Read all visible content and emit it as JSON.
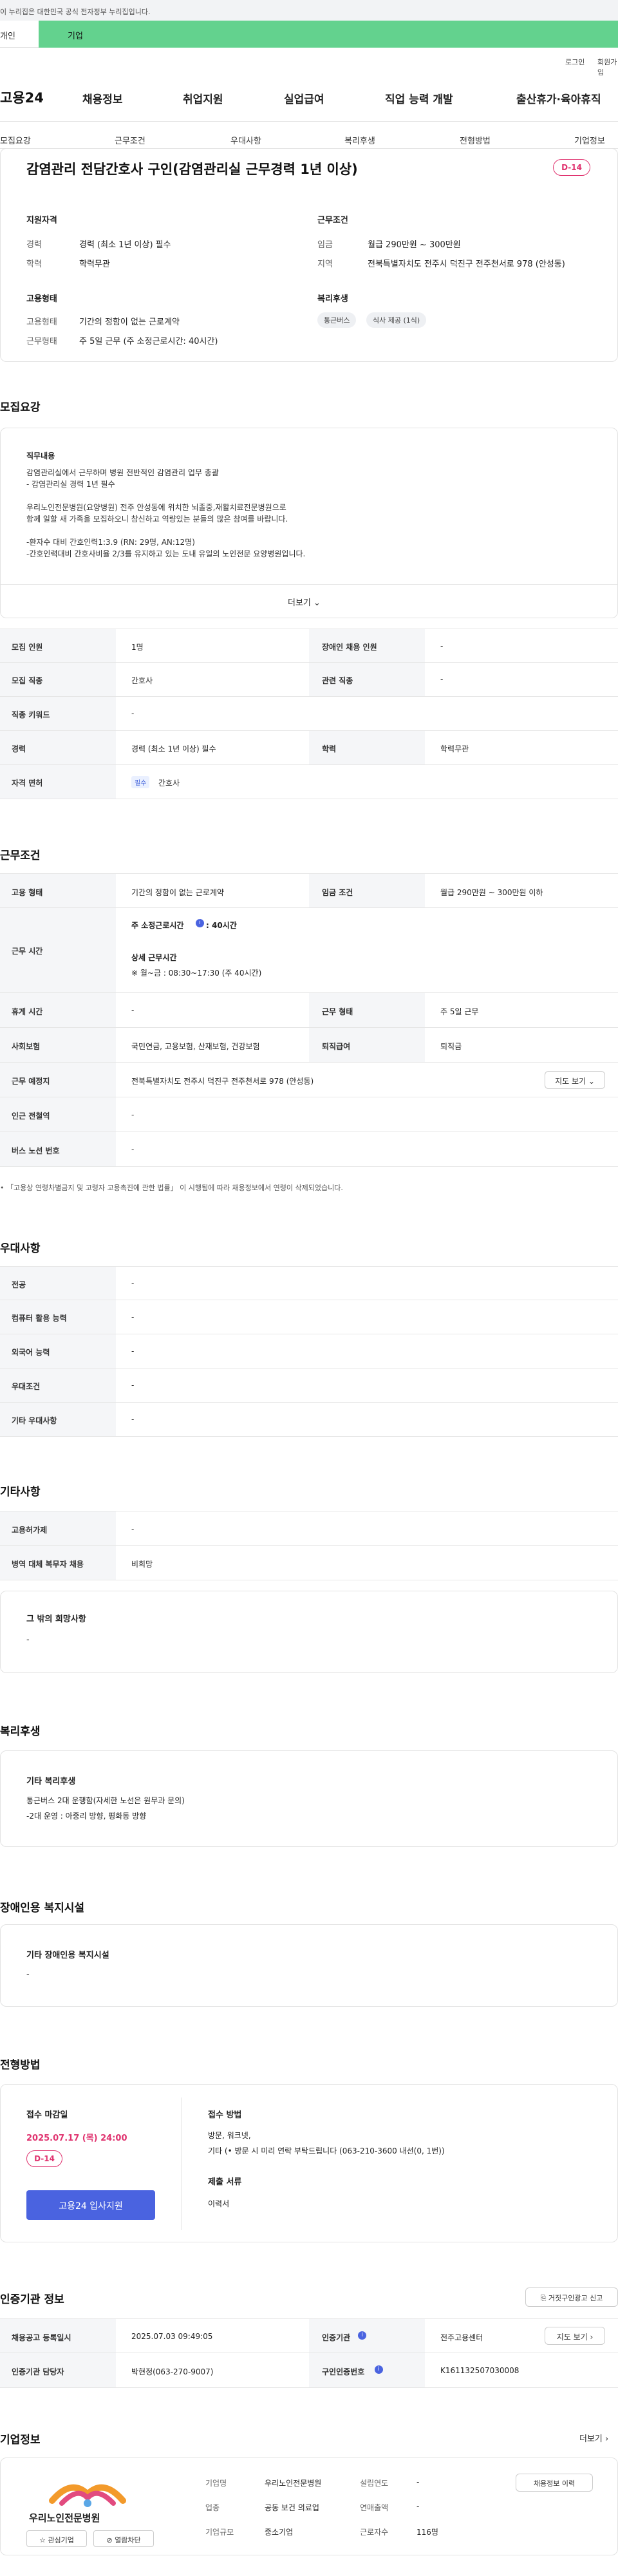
{
  "gov_banner": "이 누리집은 대한민국 공식 전자정부 누리집입니다.",
  "tabs": {
    "personal": "개인",
    "company": "기업"
  },
  "util": {
    "login": "로그인",
    "signup": "회원가입"
  },
  "logo": "고용24",
  "gnb": [
    "채용정보",
    "취업지원",
    "실업급여",
    "직업 능력 개발",
    "출산휴가·육아휴직"
  ],
  "subnav": [
    "모집요강",
    "근무조건",
    "우대사항",
    "복리후생",
    "전형방법",
    "기업정보"
  ],
  "job": {
    "title": "감염관리 전담간호사 구인(감염관리실 근무경력 1년 이상)",
    "dday": "D-14",
    "qual_title": "지원자격",
    "cond_title": "근무조건",
    "qual": [
      {
        "k": "경력",
        "v": "경력 (최소 1년 이상) 필수"
      },
      {
        "k": "학력",
        "v": "학력무관"
      }
    ],
    "cond": [
      {
        "k": "임금",
        "v": "월급 290만원 ~ 300만원"
      },
      {
        "k": "지역",
        "v": "전북특별자치도 전주시 덕진구 전주천서로 978 (안성동)"
      }
    ],
    "emp_title": "고용형태",
    "welfare_title": "복리후생",
    "emp": [
      {
        "k": "고용형태",
        "v": "기간의 정함이 없는 근로계약"
      },
      {
        "k": "근무형태",
        "v": "주 5일 근무 (주 소정근로시간: 40시간)"
      }
    ],
    "welfare_chips": [
      "통근버스",
      "식사 제공 (1식)"
    ]
  },
  "recruit": {
    "section": "모집요강",
    "duty_title": "직무내용",
    "duty_lines": [
      "감염관리실에서 근무하며 병원 전반적인 감염관리 업무 총괄",
      "- 감염관리실 경력 1년 필수",
      "",
      "우리노인전문병원(요양병원) 전주 안성동에 위치한 뇌졸중,재활치료전문병원으로",
      "함께 일할 새 가족을 모집하오니 참신하고 역량있는 분들의 많은 참여를 바랍니다.",
      "",
      "-환자수 대비 간호인력1:3.9 (RN: 29명, AN:12명)",
      "-간호인력대비 간호사비율 2/3를 유지하고 있는 도내 유일의 노인전문 요양병원입니다."
    ],
    "more": "더보기",
    "rows": [
      {
        "h1": "모집 인원",
        "v1": "1명",
        "h2": "장애인 채용 인원",
        "v2": "-"
      },
      {
        "h1": "모집 직종",
        "v1": "간호사",
        "h2": "관련 직종",
        "v2": "-"
      },
      {
        "h1": "직종 키워드",
        "v1": "-"
      },
      {
        "h1": "경력",
        "v1": "경력 (최소 1년 이상) 필수",
        "h2": "학력",
        "v2": "학력무관"
      },
      {
        "h1": "자격 면허",
        "badge": "필수",
        "v1": "간호사"
      }
    ]
  },
  "work": {
    "section": "근무조건",
    "emp_type_h": "고용 형태",
    "emp_type": "기간의 정함이 없는 근로계약",
    "wage_h": "임금 조건",
    "wage": "월급 290만원 ~ 300만원 이하",
    "hours_h": "근무 시간",
    "hours_main_label": "주 소정근로시간",
    "hours_main_val": ": 40시간",
    "hours_detail_title": "상세 근무시간",
    "hours_detail": "※ 월~금 : 08:30~17:30 (주 40시간)",
    "rest_h": "휴게 시간",
    "rest": "-",
    "form_h": "근무 형태",
    "form": "주 5일 근무",
    "ins_h": "사회보험",
    "ins": "국민연금, 고용보험, 산재보험, 건강보험",
    "sev_h": "퇴직급여",
    "sev": "퇴직금",
    "place_h": "근무 예정지",
    "place": "전북특별자치도 전주시 덕진구 전주천서로 978 (안성동)",
    "map_btn": "지도 보기",
    "station_h": "인근 전철역",
    "station": "-",
    "bus_h": "버스 노선 번호",
    "bus": "-",
    "note": "「고용상 연령차별금지 및 고령자 고용촉진에 관한 법률」 이 시행됨에 따라 채용정보에서 연령이 삭제되었습니다."
  },
  "pref": {
    "section": "우대사항",
    "rows": [
      {
        "h": "전공",
        "v": "-"
      },
      {
        "h": "컴퓨터 활용 능력",
        "v": "-"
      },
      {
        "h": "외국어 능력",
        "v": "-"
      },
      {
        "h": "우대조건",
        "v": "-"
      },
      {
        "h": "기타 우대사항",
        "v": "-"
      }
    ]
  },
  "etc": {
    "section": "기타사항",
    "rows": [
      {
        "h": "고용허가제",
        "v": "-"
      },
      {
        "h": "병역 대체 복무자 채용",
        "v": "비희망"
      }
    ],
    "other_title": "그 밖의 희망사항",
    "other": "-"
  },
  "welfare": {
    "section": "복리후생",
    "title": "기타 복리후생",
    "lines": [
      "통근버스 2대 운행함(자세한 노선은 원무과 문의)",
      "-2대 운영 : 아중리 방향, 평화동 방향"
    ]
  },
  "disability": {
    "section": "장애인용 복지시설",
    "title": "기타 장애인용 복지시설",
    "value": "-"
  },
  "selection": {
    "section": "전형방법",
    "deadline_title": "접수 마감일",
    "deadline": "2025.07.17 (목) 24:00",
    "dday": "D-14",
    "apply_btn": "고용24 입사지원",
    "method_title": "접수 방법",
    "method_lines": [
      "방문, 워크넷,",
      "기타 (• 방문 시 미리 연락 부탁드립니다 (063-210-3600 내선(0, 1번))"
    ],
    "docs_title": "제출 서류",
    "docs": "이력서"
  },
  "cert": {
    "section": "인증기관 정보",
    "report_btn": "거짓구인광고 신고",
    "rows": [
      {
        "h1": "채용공고 등록일시",
        "v1": "2025.07.03 09:49:05",
        "h2": "인증기관",
        "v2": "전주고용센터",
        "btn": "지도 보기"
      },
      {
        "h1": "인증기관 담당자",
        "v1": "박현정(063-270-9007)",
        "h2": "구인인증번호",
        "v2": "K161132507030008"
      }
    ]
  },
  "company": {
    "section": "기업정보",
    "more": "더보기",
    "logo_text": "우리노인전문병원",
    "fav": "관심기업",
    "block": "열람차단",
    "info": [
      {
        "k": "기업명",
        "v": "우리노인전문병원",
        "k2": "설립연도",
        "v2": "-"
      },
      {
        "k": "업종",
        "v": "공동 보건 의료업",
        "k2": "연매출액",
        "v2": "-"
      },
      {
        "k": "기업규모",
        "v": "중소기업",
        "k2": "근로자수",
        "v2": "116명"
      }
    ],
    "jobs_btn": "채용정보 이력"
  },
  "colors": {
    "tab_green": "#63d28e",
    "accent_red": "#e0336f",
    "primary_blue": "#4a63e0"
  }
}
